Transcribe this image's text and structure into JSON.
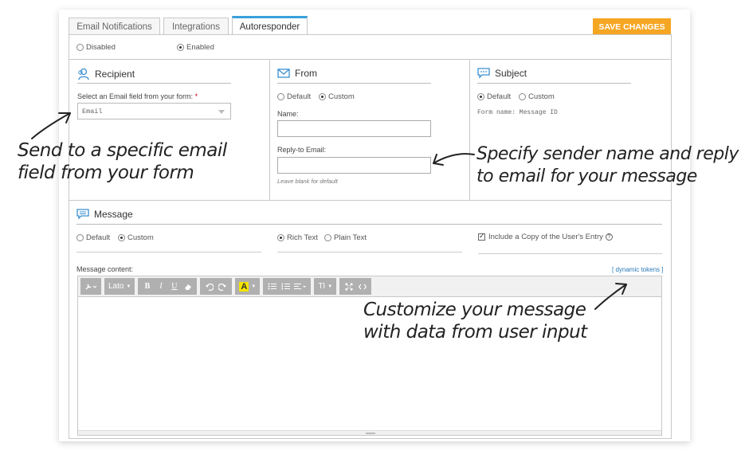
{
  "tabs": [
    {
      "label": "Email Notifications"
    },
    {
      "label": "Integrations"
    },
    {
      "label": "Autoresponder"
    }
  ],
  "save_label": "SAVE CHANGES",
  "status": {
    "disabled": "Disabled",
    "enabled": "Enabled"
  },
  "recipient": {
    "title": "Recipient",
    "field_label": "Select an Email field from your form:",
    "required_mark": "*",
    "select_value": "Email"
  },
  "from": {
    "title": "From",
    "opt_default": "Default",
    "opt_custom": "Custom",
    "name_label": "Name:",
    "reply_label": "Reply-to Email:",
    "reply_hint": "Leave blank for default"
  },
  "subject": {
    "title": "Subject",
    "opt_default": "Default",
    "opt_custom": "Custom",
    "form_name": "Form name: Message ID"
  },
  "message": {
    "title": "Message",
    "opt_default": "Default",
    "opt_custom": "Custom",
    "rich_text": "Rich Text",
    "plain_text": "Plain Text",
    "include_copy": "Include a Copy of the User's Entry",
    "content_label": "Message content:",
    "tokens_link": "[ dynamic tokens ]"
  },
  "toolbar": {
    "font": "Lato",
    "bold": "B",
    "italic": "I",
    "underline": "U",
    "color": "A",
    "size": "TI"
  },
  "annotations": {
    "recipient_line1": "Send to a specific email",
    "recipient_line2": "field from your form",
    "from_line1": "Specify sender name and reply",
    "from_line2": "to email for your message",
    "message_line1": "Customize your message",
    "message_line2": "with data from user input"
  },
  "colors": {
    "accent": "#f5a623",
    "tab_active": "#3aa0dc",
    "icon": "#3a8fd0"
  }
}
